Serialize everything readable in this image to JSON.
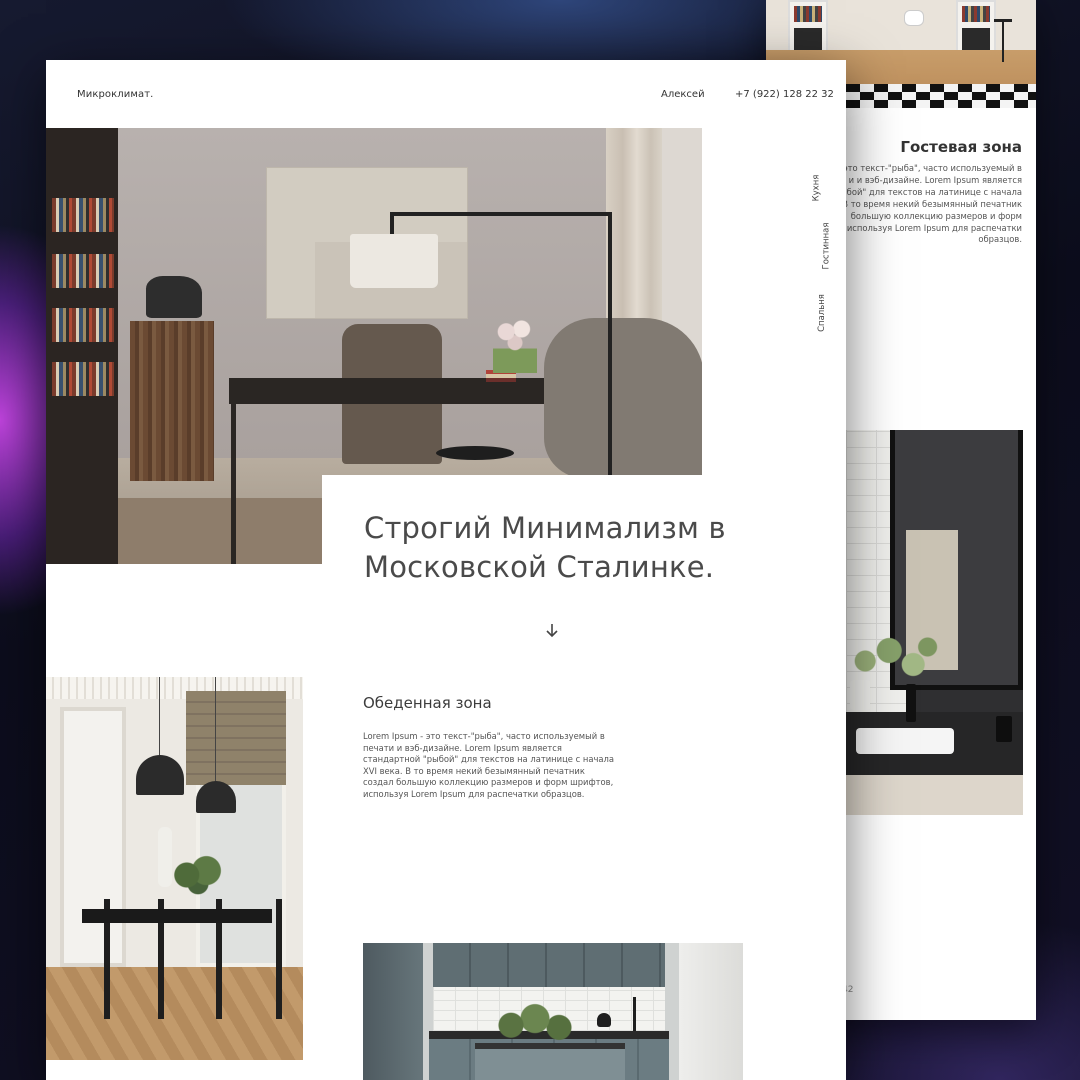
{
  "back_page": {
    "section_title": "Гостевая зона",
    "text": "это текст-\"рыба\", часто используемый в\nи и вэб-дизайне. Lorem Ipsum является\nрыбой\" для текстов на латинице с начала\nВ то время некий безымянный печатник\nбольшую коллекцию размеров и форм\nиспользуя Lorem Ipsum для распечатки\nобразцов.",
    "page_number": "42"
  },
  "header": {
    "logo": "Микроклимат.",
    "user_name": "Алексей",
    "phone": "+7 (922) 128 22 32"
  },
  "side_nav": {
    "items": [
      {
        "label": "Кухня"
      },
      {
        "label": "Гостинная"
      },
      {
        "label": "Спальня"
      }
    ]
  },
  "hero": {
    "title": "Строгий Минимализм в Московской Сталинке.",
    "arrow_icon": "arrow-down-icon"
  },
  "dining": {
    "title": "Обеденная зона",
    "text": "Lorem Ipsum - это текст-\"рыба\", часто используемый в печати и вэб-дизайне. Lorem Ipsum является стандартной \"рыбой\" для текстов на латинице с начала XVI века. В то время некий безымянный печатник создал большую коллекцию размеров и форм шрифтов, используя Lorem Ipsum для распечатки образцов."
  },
  "colors": {
    "page_background": "#ffffff",
    "text_primary": "#4a4a4a",
    "backdrop_dark": "#0c0d1c",
    "backdrop_glow": "#c846e6"
  }
}
